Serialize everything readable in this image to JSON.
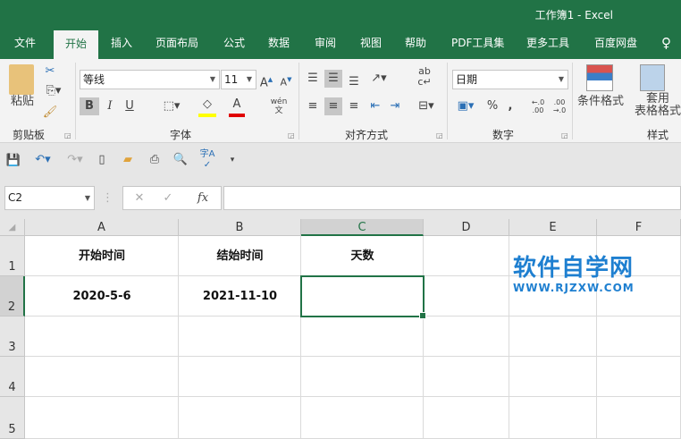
{
  "window": {
    "title": "工作簿1  -  Excel"
  },
  "tabs": [
    "文件",
    "开始",
    "插入",
    "页面布局",
    "公式",
    "数据",
    "审阅",
    "视图",
    "帮助",
    "PDF工具集",
    "更多工具",
    "百度网盘"
  ],
  "active_tab": "开始",
  "ribbon": {
    "clipboard": {
      "label": "剪贴板",
      "paste": "粘贴"
    },
    "font": {
      "label": "字体",
      "font_name": "等线",
      "font_size": "11",
      "bold": "B",
      "italic": "I",
      "underline": "U",
      "phonetic": "wén"
    },
    "alignment": {
      "label": "对齐方式"
    },
    "number": {
      "label": "数字",
      "format": "日期",
      "percent": "%",
      "comma": ","
    },
    "styles": {
      "label": "样式",
      "conditional": "条件格式",
      "table_format_1": "套用",
      "table_format_2": "表格格式"
    }
  },
  "formula_bar": {
    "name_box": "C2",
    "fx": "fx",
    "value": ""
  },
  "colors": {
    "accent": "#217346",
    "fill_color": "#ffff00",
    "font_color": "#ff0000",
    "watermark": "#1e7fd0"
  },
  "sheet": {
    "columns": [
      "A",
      "B",
      "C",
      "D",
      "E",
      "F"
    ],
    "rows": [
      "1",
      "2",
      "3",
      "4",
      "5"
    ],
    "cells": {
      "A1": "开始时间",
      "B1": "结始时间",
      "C1": "天数",
      "A2": "2020-5-6",
      "B2": "2021-11-10",
      "C2": ""
    },
    "selected": "C2"
  },
  "watermark": {
    "title": "软件自学网",
    "url": "WWW.RJZXW.COM"
  }
}
